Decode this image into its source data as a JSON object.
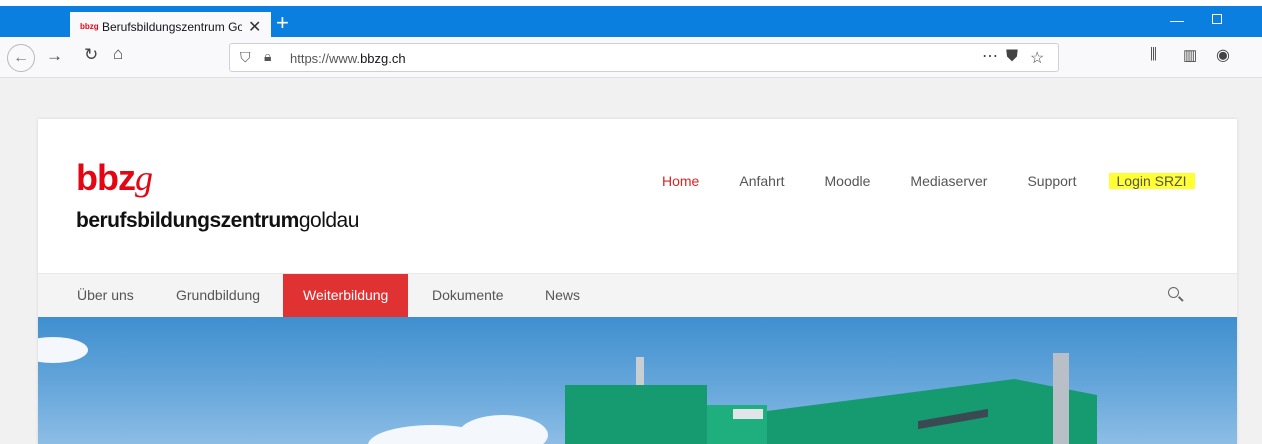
{
  "browser": {
    "tab": {
      "favicon_text": "bbzg",
      "title": "Berufsbildungszentrum Goldau",
      "close": "✕"
    },
    "new_tab": "+",
    "url": {
      "prefix": "https://www.",
      "domain": "bbzg.ch"
    },
    "icons": [
      "back-icon",
      "forward-icon",
      "reload-icon",
      "home-icon",
      "shield-icon",
      "lock-icon",
      "more-icon",
      "pocket-icon",
      "star-icon",
      "library-icon",
      "sidebar-icon",
      "account-icon"
    ]
  },
  "logo": {
    "main": "bbz",
    "main_g": "g",
    "sub_strong": "berufsbildungszentrum",
    "sub_light": "goldau"
  },
  "topnav": [
    "Home",
    "Anfahrt",
    "Moodle",
    "Mediaserver",
    "Support",
    "Login SRZI"
  ],
  "subnav": [
    "Über uns",
    "Grundbildung",
    "Weiterbildung",
    "Dokumente",
    "News"
  ],
  "colors": {
    "accent": "#e03232",
    "browser_blue": "#0b7fe0",
    "highlight": "#ffff33"
  }
}
